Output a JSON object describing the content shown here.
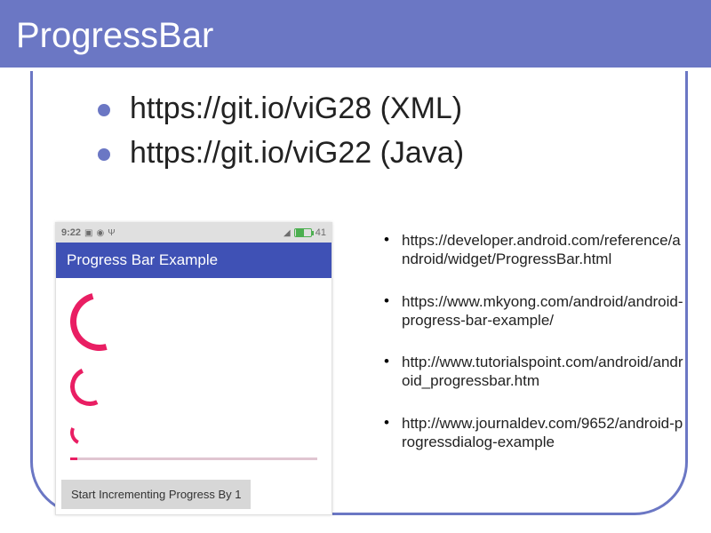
{
  "slide": {
    "title": "ProgressBar",
    "links": [
      "https://git.io/viG28 (XML)",
      "https://git.io/viG22 (Java)"
    ],
    "refs": [
      "https://developer.android.com/reference/android/widget/ProgressBar.html",
      "https://www.mkyong.com/android/android-progress-bar-example/",
      "http://www.tutorialspoint.com/android/android_progressbar.htm",
      "http://www.journaldev.com/9652/android-progressdialog-example"
    ]
  },
  "phone": {
    "status": {
      "time": "9:22",
      "battery_pct": "41"
    },
    "app_title": "Progress Bar Example",
    "button": "Start Incrementing Progress By 1"
  }
}
